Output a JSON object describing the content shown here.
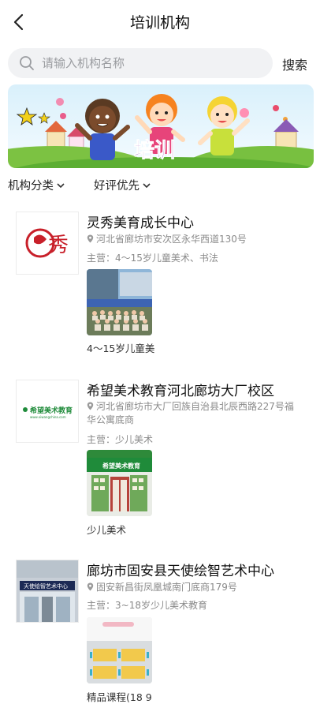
{
  "header": {
    "title": "培训机构"
  },
  "search": {
    "placeholder": "请输入机构名称",
    "button_label": "搜索"
  },
  "banner": {
    "text": "培训"
  },
  "filters": [
    {
      "label": "机构分类"
    },
    {
      "label": "好评优先"
    }
  ],
  "institutions": [
    {
      "name": "灵秀美育成长中心",
      "address": "河北省廊坊市安次区永华西道130号",
      "main_business": "主营：4～15岁儿童美术、书法",
      "caption": "4～15岁儿童美",
      "logo_text": "秀"
    },
    {
      "name": "希望美术教育河北廊坊大厂校区",
      "address": "河北省廊坊市大厂回族自治县北辰西路227号福华公寓底商",
      "main_business": "主营：少儿美术",
      "caption": "少儿美术",
      "logo_text": "希望美术教育",
      "logo_subtext": "www.xiwangchina.com",
      "photo_sign": "希望美术教育"
    },
    {
      "name": "廊坊市固安县天使绘智艺术中心",
      "address": "固安新昌街凤凰城南门底商179号",
      "main_business": "主营：3~18岁少儿美术教育",
      "caption": "精品课程(18 9",
      "logo_sign": "天使绘智艺术中心"
    }
  ],
  "colors": {
    "accent_green": "#1f8b3a",
    "logo_red": "#c8202a",
    "search_bg": "#f1f2f4"
  }
}
